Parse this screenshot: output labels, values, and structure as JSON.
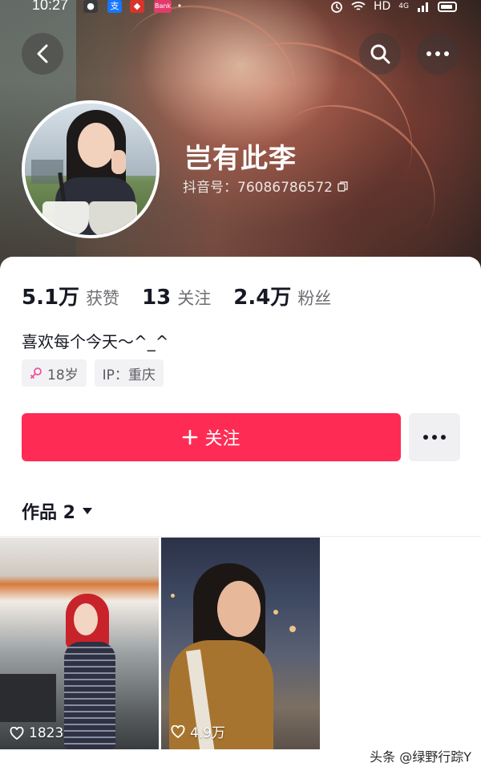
{
  "status_bar": {
    "time": "10:27",
    "network": "HD",
    "signal_label": "4G"
  },
  "header": {
    "back_icon": "chevron-left-icon",
    "search_icon": "search-icon",
    "more_icon": "more-horizontal-icon"
  },
  "profile": {
    "nickname": "岂有此李",
    "douyin_id": "抖音号：76086786572",
    "stats": [
      {
        "value": "5.1万",
        "label": "获赞"
      },
      {
        "value": "13",
        "label": "关注"
      },
      {
        "value": "2.4万",
        "label": "粉丝"
      }
    ],
    "bio": "喜欢每个今天～^_^",
    "tags": [
      {
        "icon": "female-icon",
        "label": "18岁"
      },
      {
        "icon": "",
        "label": "IP：重庆"
      }
    ]
  },
  "actions": {
    "follow_label": "关注",
    "follow_color": "#fe2c55"
  },
  "works": {
    "title": "作品 2",
    "items": [
      {
        "likes": "1823"
      },
      {
        "likes": "4.9万"
      }
    ]
  },
  "watermark": "头条 @绿野行踪Y"
}
